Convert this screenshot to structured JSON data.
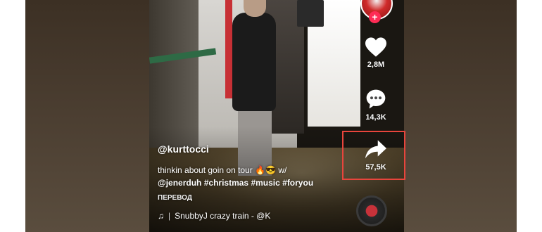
{
  "post": {
    "username": "@kurttocci",
    "caption_text": "thinkin about goin on tour 🔥😎 w/",
    "caption_mention": "@jenerduh",
    "hashtags": [
      "#christmas",
      "#music",
      "#foryou"
    ],
    "translate_label": "ПЕРЕВОД",
    "music_title": "SnubbyJ crazy train - @K"
  },
  "actions": {
    "likes": "2,8M",
    "comments": "14,3K",
    "shares": "57,5K"
  },
  "icons": {
    "like": "heart-icon",
    "comment": "comment-icon",
    "share": "share-arrow-icon",
    "music": "music-note-icon",
    "follow": "plus-icon"
  },
  "colors": {
    "highlight": "#e8453c",
    "follow_badge": "#fe2c55"
  }
}
